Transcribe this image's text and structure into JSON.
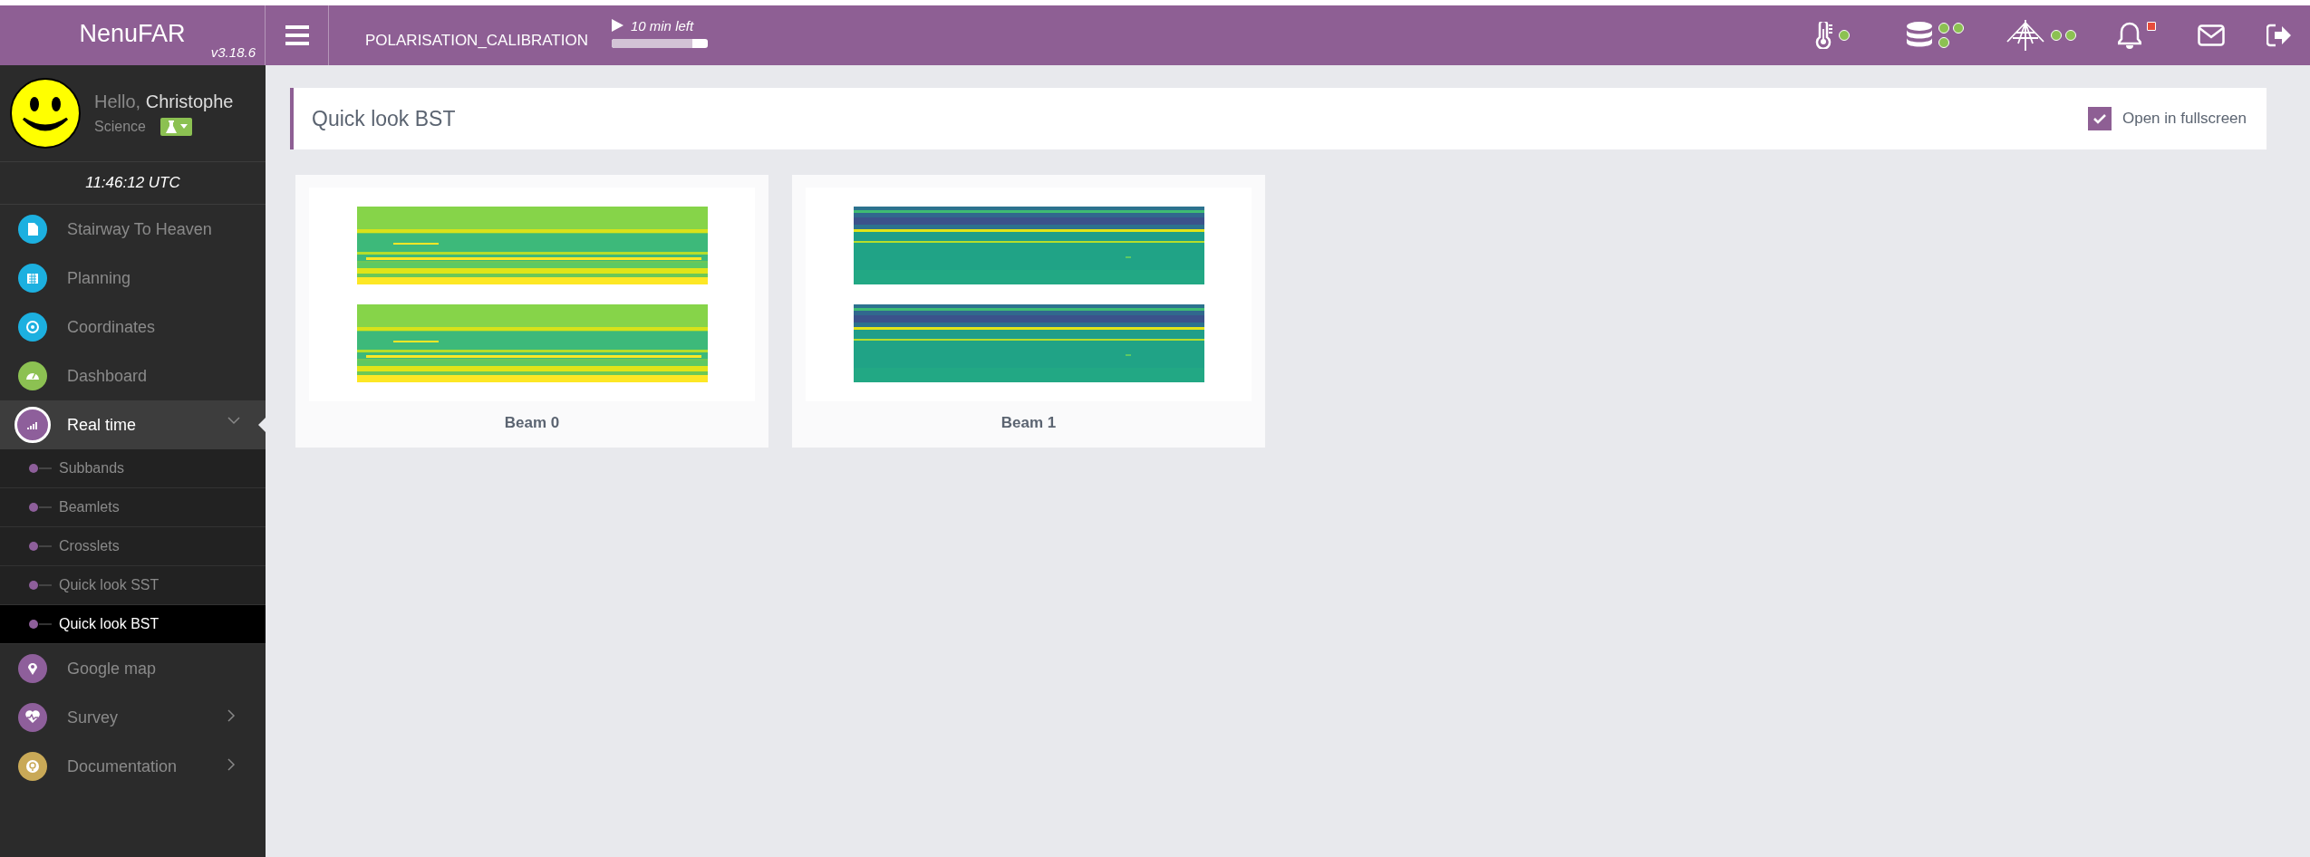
{
  "brand": {
    "name": "NenuFAR",
    "version": "v3.18.6"
  },
  "session": {
    "name": "POLARISATION_CALIBRATION",
    "time_left": "10 min left",
    "level": 0.84
  },
  "status_icons": [
    {
      "kind": "thermometer",
      "dots": [
        {
          "color": "#8cc152"
        }
      ]
    },
    {
      "kind": "database",
      "dots": [
        {
          "color": "#8cc152"
        },
        {
          "color": "#8cc152"
        },
        {
          "color": "#8cc152"
        }
      ]
    },
    {
      "kind": "antenna",
      "dots": [
        {
          "color": "#8cc152"
        },
        {
          "color": "#8cc152"
        }
      ]
    },
    {
      "kind": "bell",
      "dots": [
        {
          "color": "#e74c3c"
        }
      ]
    },
    {
      "kind": "mail"
    },
    {
      "kind": "logout"
    }
  ],
  "user": {
    "greeting": "Hello,",
    "name": "Christophe",
    "role": "Science"
  },
  "clock": "11:46:12 UTC",
  "sidebar": {
    "items": [
      {
        "label": "Stairway To Heaven",
        "color": "#1cb0e0",
        "kind": "link",
        "selected": false
      },
      {
        "label": "Planning",
        "color": "#1cb0e0",
        "kind": "link",
        "selected": false
      },
      {
        "label": "Coordinates",
        "color": "#1cb0e0",
        "kind": "link",
        "selected": false
      },
      {
        "label": "Dashboard",
        "color": "#8cc152",
        "kind": "link",
        "selected": false
      },
      {
        "label": "Real time",
        "color": "#8e5f9b",
        "kind": "group",
        "selected": true,
        "expanded": true,
        "children": [
          {
            "label": "Subbands",
            "selected": false
          },
          {
            "label": "Beamlets",
            "selected": false
          },
          {
            "label": "Crosslets",
            "selected": false
          },
          {
            "label": "Quick look SST",
            "selected": false
          },
          {
            "label": "Quick look BST",
            "selected": true
          }
        ]
      },
      {
        "label": "Google map",
        "color": "#8e5f9b",
        "kind": "link",
        "selected": false
      },
      {
        "label": "Survey",
        "color": "#8e5f9b",
        "kind": "group",
        "selected": false,
        "expanded": false
      },
      {
        "label": "Documentation",
        "color": "#c9a957",
        "kind": "group",
        "selected": false,
        "expanded": false
      }
    ]
  },
  "header": {
    "title": "Quick look BST",
    "fullscreen": {
      "label": "Open in fullscreen",
      "checked": true
    }
  },
  "cards": [
    {
      "caption": "Beam 0",
      "kind": "bright"
    },
    {
      "caption": "Beam 1",
      "kind": "dark"
    }
  ]
}
